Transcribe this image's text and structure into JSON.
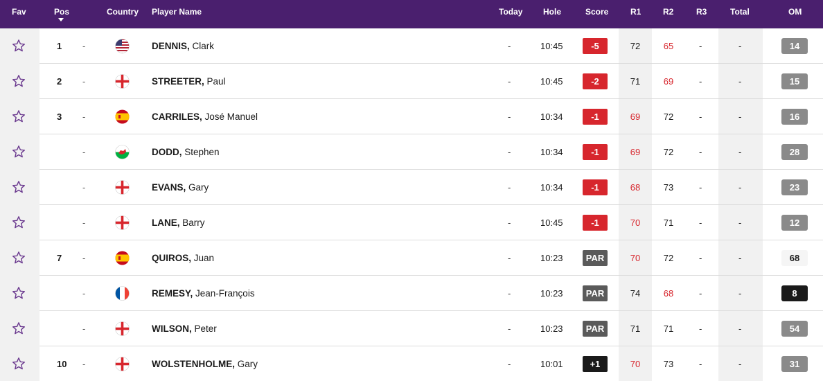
{
  "header": {
    "fav": "Fav",
    "pos": "Pos",
    "country": "Country",
    "player": "Player Name",
    "today": "Today",
    "hole": "Hole",
    "score": "Score",
    "r1": "R1",
    "r2": "R2",
    "r3": "R3",
    "total": "Total",
    "om": "OM"
  },
  "colors": {
    "header_bg": "#4a1f6e",
    "under_par": "#d7262d",
    "par": "#5a5a5a",
    "over_par": "#1a1a1a",
    "star_outline": "#6b3a8f"
  },
  "rows": [
    {
      "pos": "1",
      "move": "-",
      "country": "usa-flag",
      "last": "DENNIS,",
      "first": " Clark",
      "today": "-",
      "hole": "10:45",
      "score": "-5",
      "score_style": "red",
      "r1": "72",
      "r1_red": false,
      "r2": "65",
      "r2_red": true,
      "r3": "-",
      "total": "-",
      "om": "14",
      "om_style": "grey"
    },
    {
      "pos": "2",
      "move": "-",
      "country": "england-flag",
      "last": "STREETER,",
      "first": " Paul",
      "today": "-",
      "hole": "10:45",
      "score": "-2",
      "score_style": "red",
      "r1": "71",
      "r1_red": false,
      "r2": "69",
      "r2_red": true,
      "r3": "-",
      "total": "-",
      "om": "15",
      "om_style": "grey"
    },
    {
      "pos": "3",
      "move": "-",
      "country": "spain-flag",
      "last": "CARRILES,",
      "first": " José Manuel",
      "today": "-",
      "hole": "10:34",
      "score": "-1",
      "score_style": "red",
      "r1": "69",
      "r1_red": true,
      "r2": "72",
      "r2_red": false,
      "r3": "-",
      "total": "-",
      "om": "16",
      "om_style": "grey"
    },
    {
      "pos": "",
      "move": "-",
      "country": "wales-flag",
      "last": "DODD,",
      "first": " Stephen",
      "today": "-",
      "hole": "10:34",
      "score": "-1",
      "score_style": "red",
      "r1": "69",
      "r1_red": true,
      "r2": "72",
      "r2_red": false,
      "r3": "-",
      "total": "-",
      "om": "28",
      "om_style": "grey"
    },
    {
      "pos": "",
      "move": "-",
      "country": "england-flag",
      "last": "EVANS,",
      "first": " Gary",
      "today": "-",
      "hole": "10:34",
      "score": "-1",
      "score_style": "red",
      "r1": "68",
      "r1_red": true,
      "r2": "73",
      "r2_red": false,
      "r3": "-",
      "total": "-",
      "om": "23",
      "om_style": "grey"
    },
    {
      "pos": "",
      "move": "-",
      "country": "england-flag",
      "last": "LANE,",
      "first": " Barry",
      "today": "-",
      "hole": "10:45",
      "score": "-1",
      "score_style": "red",
      "r1": "70",
      "r1_red": true,
      "r2": "71",
      "r2_red": false,
      "r3": "-",
      "total": "-",
      "om": "12",
      "om_style": "grey"
    },
    {
      "pos": "7",
      "move": "-",
      "country": "spain-flag",
      "last": "QUIROS,",
      "first": " Juan",
      "today": "-",
      "hole": "10:23",
      "score": "PAR",
      "score_style": "grey",
      "r1": "70",
      "r1_red": true,
      "r2": "72",
      "r2_red": false,
      "r3": "-",
      "total": "-",
      "om": "68",
      "om_style": "light"
    },
    {
      "pos": "",
      "move": "-",
      "country": "france-flag",
      "last": "REMESY,",
      "first": " Jean-François",
      "today": "-",
      "hole": "10:23",
      "score": "PAR",
      "score_style": "grey",
      "r1": "74",
      "r1_red": false,
      "r2": "68",
      "r2_red": true,
      "r3": "-",
      "total": "-",
      "om": "8",
      "om_style": "black"
    },
    {
      "pos": "",
      "move": "-",
      "country": "england-flag",
      "last": "WILSON,",
      "first": " Peter",
      "today": "-",
      "hole": "10:23",
      "score": "PAR",
      "score_style": "grey",
      "r1": "71",
      "r1_red": false,
      "r2": "71",
      "r2_red": false,
      "r3": "-",
      "total": "-",
      "om": "54",
      "om_style": "grey"
    },
    {
      "pos": "10",
      "move": "-",
      "country": "england-flag",
      "last": "WOLSTENHOLME,",
      "first": " Gary",
      "today": "-",
      "hole": "10:01",
      "score": "+1",
      "score_style": "black",
      "r1": "70",
      "r1_red": true,
      "r2": "73",
      "r2_red": false,
      "r3": "-",
      "total": "-",
      "om": "31",
      "om_style": "grey"
    }
  ]
}
